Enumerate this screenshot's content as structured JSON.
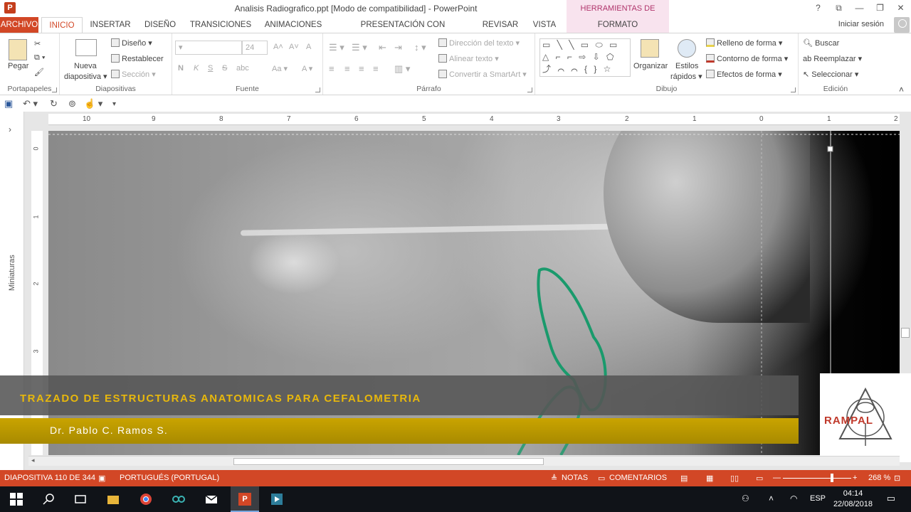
{
  "window": {
    "title": "Analisis Radiografico.ppt [Modo de compatibilidad] - PowerPoint",
    "app_icon": "P",
    "context_tools": "HERRAMIENTAS DE IMAGEN",
    "controls": [
      "?",
      "⧉",
      "—",
      "❐",
      "✕"
    ]
  },
  "tabs": {
    "archivo": "ARCHIVO",
    "inicio": "INICIO",
    "insertar": "INSERTAR",
    "diseno": "DISEÑO",
    "transiciones": "TRANSICIONES",
    "animaciones": "ANIMACIONES",
    "presentacion": "PRESENTACIÓN CON DIAPOSITIVAS",
    "revisar": "REVISAR",
    "vista": "VISTA",
    "formato": "FORMATO",
    "signin": "Iniciar sesión"
  },
  "ribbon": {
    "portapapeles": {
      "label": "Portapapeles",
      "pegar": "Pegar"
    },
    "diapositivas": {
      "label": "Diapositivas",
      "nueva": "Nueva",
      "diapositiva": "diapositiva ▾",
      "diseno": "Diseño ▾",
      "restablecer": "Restablecer",
      "seccion": "Sección ▾"
    },
    "fuente": {
      "label": "Fuente",
      "size": "24",
      "bold": "N",
      "italic": "K",
      "underline": "S",
      "strike": "S",
      "spacing": "abc",
      "case": "Aa ▾",
      "color": "A ▾",
      "grow": "A˄",
      "shrink": "A˅",
      "clear": "A"
    },
    "parrafo": {
      "label": "Párrafo",
      "direccion": "Dirección del texto ▾",
      "alinear": "Alinear texto ▾",
      "smartart": "Convertir a SmartArt ▾"
    },
    "dibujo": {
      "label": "Dibujo",
      "shapes": "▭ ╲ ╲ ▭ ⬭ ▭ △ ⌐ ⌐ ⇨ ⇩ ⬠ ⤴ ⌒ ⌒ { } ☆",
      "organizar": "Organizar",
      "estilos": "Estilos",
      "rapidos": "rápidos ▾",
      "relleno": "Relleno de forma ▾",
      "contorno": "Contorno de forma ▾",
      "efectos": "Efectos de forma ▾"
    },
    "edicion": {
      "label": "Edición",
      "buscar": "Buscar",
      "reemplazar": "Reemplazar ▾",
      "seleccionar": "Seleccionar ▾"
    }
  },
  "qat": {
    "save": "💾",
    "undo": "↶ ▾",
    "redo": "↻",
    "more": "▾"
  },
  "workspace": {
    "thumbnails_label": "Miniaturas",
    "ruler_h": [
      "10",
      "9",
      "8",
      "7",
      "6",
      "5",
      "4",
      "3",
      "2",
      "1",
      "0",
      "1",
      "2"
    ],
    "ruler_v": [
      "0",
      "1",
      "2",
      "3"
    ]
  },
  "slide": {
    "title": "TRAZADO DE ESTRUCTURAS ANATOMICAS PARA CEFALOMETRIA",
    "author": "Dr. Pablo C. Ramos S.",
    "logo": "RAMPAL",
    "outline_color": "#1a9a6c"
  },
  "status": {
    "slide_counter": "DIAPOSITIVA 110 DE 344",
    "language": "PORTUGUÉS (PORTUGAL)",
    "notas": "NOTAS",
    "comentarios": "COMENTARIOS",
    "zoom": "268 %",
    "zoom_fraction": 0.72,
    "accent": "#d24726"
  },
  "taskbar": {
    "lang": "ESP",
    "time": "04:14",
    "date": "22/08/2018"
  }
}
